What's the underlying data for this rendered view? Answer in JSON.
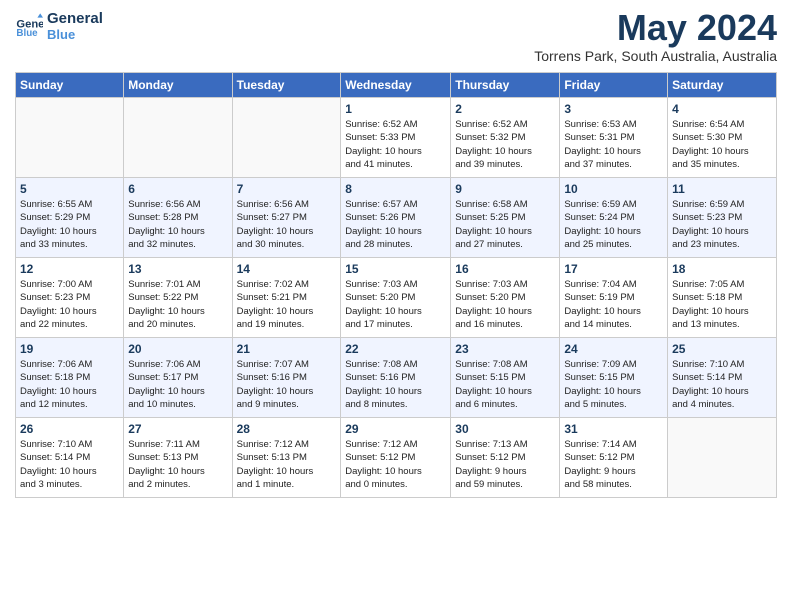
{
  "header": {
    "logo_line1": "General",
    "logo_line2": "Blue",
    "month_title": "May 2024",
    "subtitle": "Torrens Park, South Australia, Australia"
  },
  "days_of_week": [
    "Sunday",
    "Monday",
    "Tuesday",
    "Wednesday",
    "Thursday",
    "Friday",
    "Saturday"
  ],
  "weeks": [
    [
      {
        "num": "",
        "info": ""
      },
      {
        "num": "",
        "info": ""
      },
      {
        "num": "",
        "info": ""
      },
      {
        "num": "1",
        "info": "Sunrise: 6:52 AM\nSunset: 5:33 PM\nDaylight: 10 hours\nand 41 minutes."
      },
      {
        "num": "2",
        "info": "Sunrise: 6:52 AM\nSunset: 5:32 PM\nDaylight: 10 hours\nand 39 minutes."
      },
      {
        "num": "3",
        "info": "Sunrise: 6:53 AM\nSunset: 5:31 PM\nDaylight: 10 hours\nand 37 minutes."
      },
      {
        "num": "4",
        "info": "Sunrise: 6:54 AM\nSunset: 5:30 PM\nDaylight: 10 hours\nand 35 minutes."
      }
    ],
    [
      {
        "num": "5",
        "info": "Sunrise: 6:55 AM\nSunset: 5:29 PM\nDaylight: 10 hours\nand 33 minutes."
      },
      {
        "num": "6",
        "info": "Sunrise: 6:56 AM\nSunset: 5:28 PM\nDaylight: 10 hours\nand 32 minutes."
      },
      {
        "num": "7",
        "info": "Sunrise: 6:56 AM\nSunset: 5:27 PM\nDaylight: 10 hours\nand 30 minutes."
      },
      {
        "num": "8",
        "info": "Sunrise: 6:57 AM\nSunset: 5:26 PM\nDaylight: 10 hours\nand 28 minutes."
      },
      {
        "num": "9",
        "info": "Sunrise: 6:58 AM\nSunset: 5:25 PM\nDaylight: 10 hours\nand 27 minutes."
      },
      {
        "num": "10",
        "info": "Sunrise: 6:59 AM\nSunset: 5:24 PM\nDaylight: 10 hours\nand 25 minutes."
      },
      {
        "num": "11",
        "info": "Sunrise: 6:59 AM\nSunset: 5:23 PM\nDaylight: 10 hours\nand 23 minutes."
      }
    ],
    [
      {
        "num": "12",
        "info": "Sunrise: 7:00 AM\nSunset: 5:23 PM\nDaylight: 10 hours\nand 22 minutes."
      },
      {
        "num": "13",
        "info": "Sunrise: 7:01 AM\nSunset: 5:22 PM\nDaylight: 10 hours\nand 20 minutes."
      },
      {
        "num": "14",
        "info": "Sunrise: 7:02 AM\nSunset: 5:21 PM\nDaylight: 10 hours\nand 19 minutes."
      },
      {
        "num": "15",
        "info": "Sunrise: 7:03 AM\nSunset: 5:20 PM\nDaylight: 10 hours\nand 17 minutes."
      },
      {
        "num": "16",
        "info": "Sunrise: 7:03 AM\nSunset: 5:20 PM\nDaylight: 10 hours\nand 16 minutes."
      },
      {
        "num": "17",
        "info": "Sunrise: 7:04 AM\nSunset: 5:19 PM\nDaylight: 10 hours\nand 14 minutes."
      },
      {
        "num": "18",
        "info": "Sunrise: 7:05 AM\nSunset: 5:18 PM\nDaylight: 10 hours\nand 13 minutes."
      }
    ],
    [
      {
        "num": "19",
        "info": "Sunrise: 7:06 AM\nSunset: 5:18 PM\nDaylight: 10 hours\nand 12 minutes."
      },
      {
        "num": "20",
        "info": "Sunrise: 7:06 AM\nSunset: 5:17 PM\nDaylight: 10 hours\nand 10 minutes."
      },
      {
        "num": "21",
        "info": "Sunrise: 7:07 AM\nSunset: 5:16 PM\nDaylight: 10 hours\nand 9 minutes."
      },
      {
        "num": "22",
        "info": "Sunrise: 7:08 AM\nSunset: 5:16 PM\nDaylight: 10 hours\nand 8 minutes."
      },
      {
        "num": "23",
        "info": "Sunrise: 7:08 AM\nSunset: 5:15 PM\nDaylight: 10 hours\nand 6 minutes."
      },
      {
        "num": "24",
        "info": "Sunrise: 7:09 AM\nSunset: 5:15 PM\nDaylight: 10 hours\nand 5 minutes."
      },
      {
        "num": "25",
        "info": "Sunrise: 7:10 AM\nSunset: 5:14 PM\nDaylight: 10 hours\nand 4 minutes."
      }
    ],
    [
      {
        "num": "26",
        "info": "Sunrise: 7:10 AM\nSunset: 5:14 PM\nDaylight: 10 hours\nand 3 minutes."
      },
      {
        "num": "27",
        "info": "Sunrise: 7:11 AM\nSunset: 5:13 PM\nDaylight: 10 hours\nand 2 minutes."
      },
      {
        "num": "28",
        "info": "Sunrise: 7:12 AM\nSunset: 5:13 PM\nDaylight: 10 hours\nand 1 minute."
      },
      {
        "num": "29",
        "info": "Sunrise: 7:12 AM\nSunset: 5:12 PM\nDaylight: 10 hours\nand 0 minutes."
      },
      {
        "num": "30",
        "info": "Sunrise: 7:13 AM\nSunset: 5:12 PM\nDaylight: 9 hours\nand 59 minutes."
      },
      {
        "num": "31",
        "info": "Sunrise: 7:14 AM\nSunset: 5:12 PM\nDaylight: 9 hours\nand 58 minutes."
      },
      {
        "num": "",
        "info": ""
      }
    ]
  ]
}
